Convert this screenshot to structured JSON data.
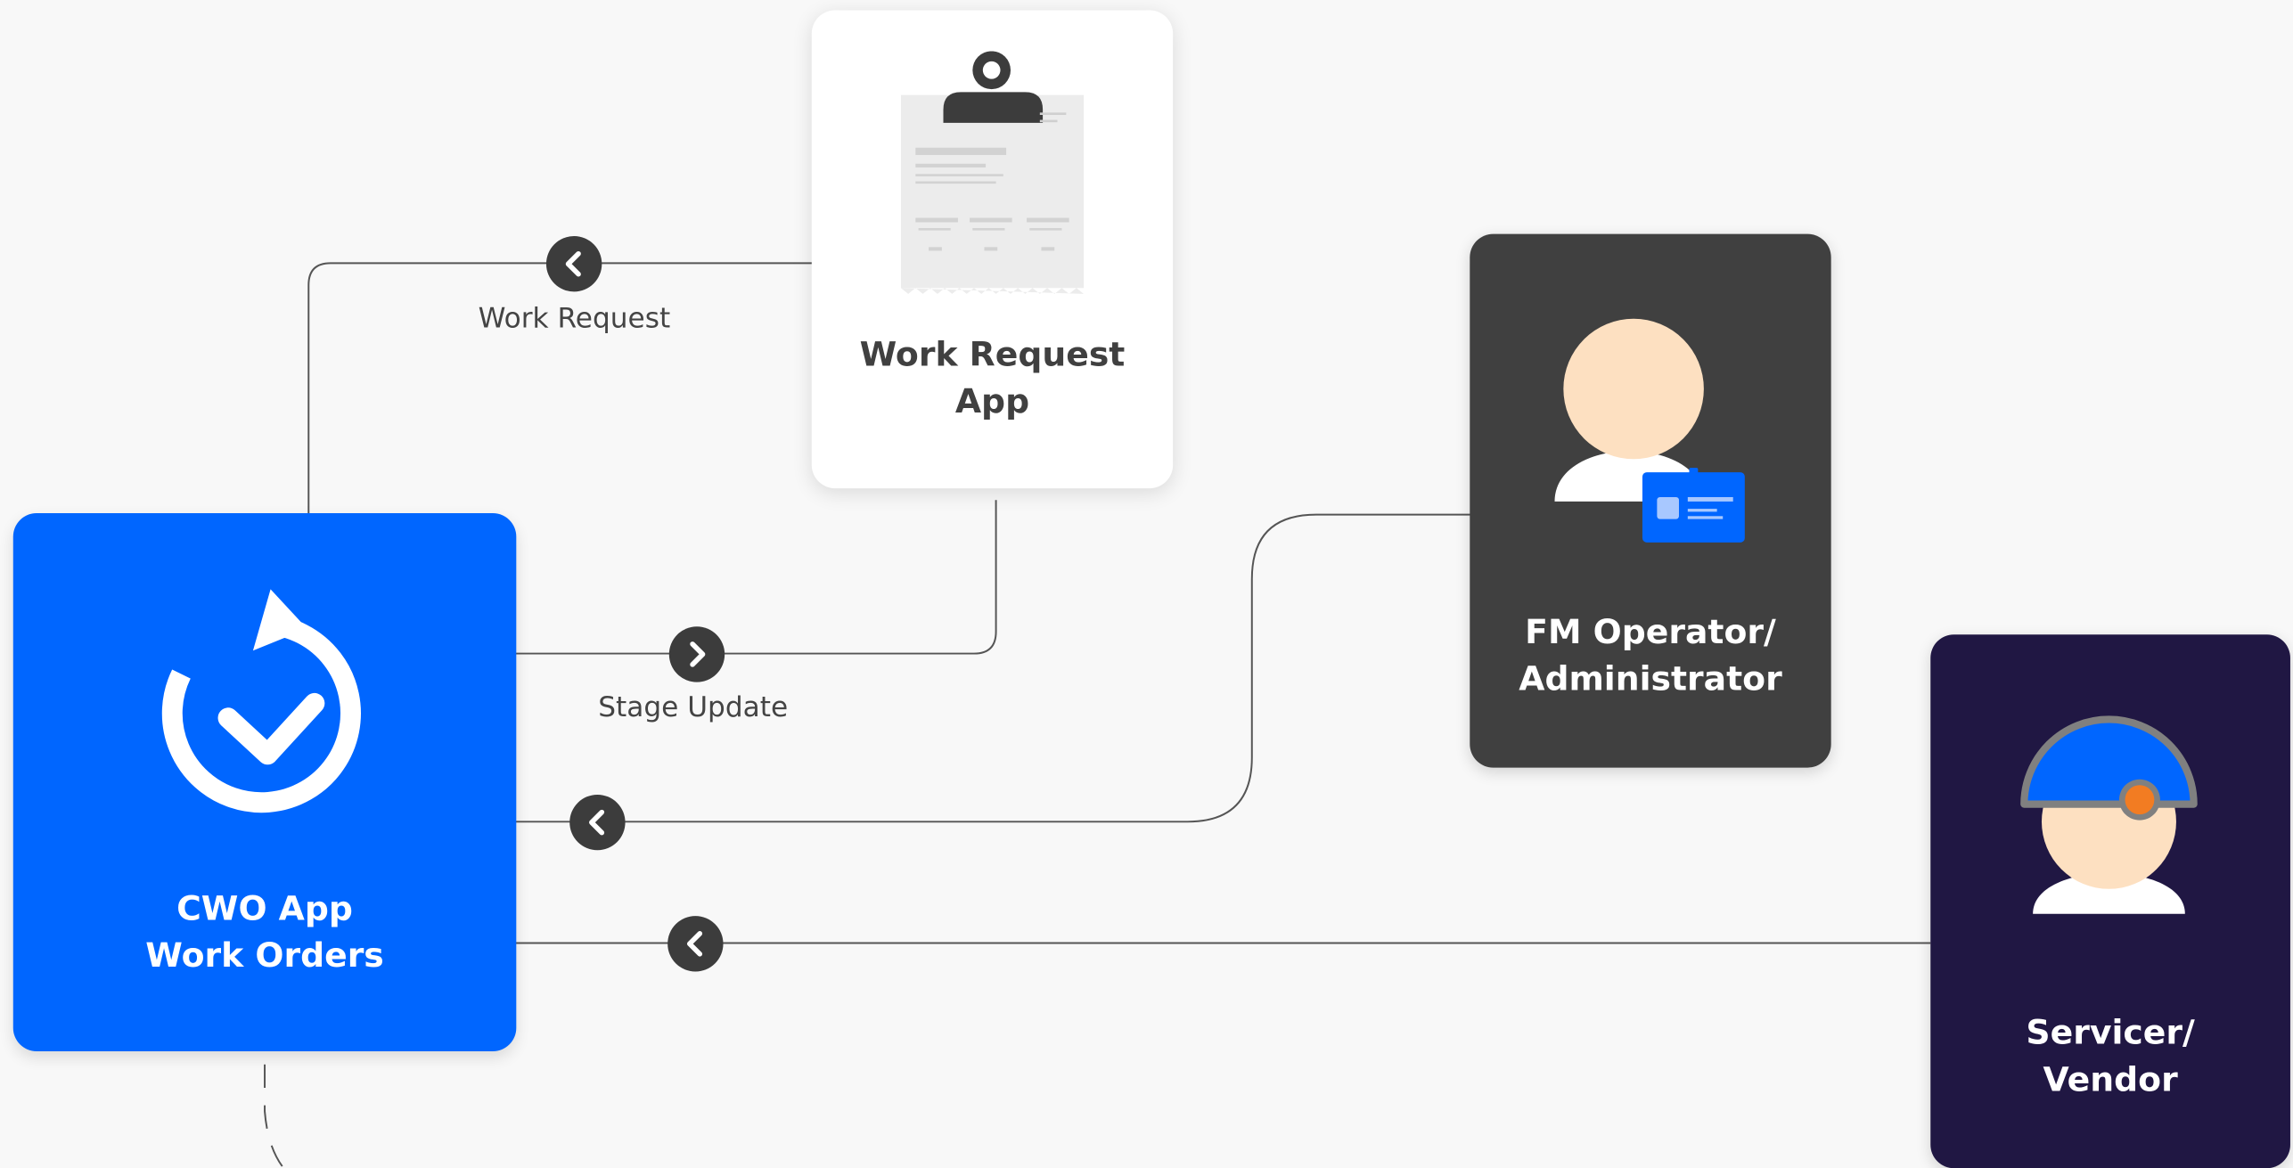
{
  "nodes": {
    "cwo": {
      "line1": "CWO App",
      "line2": "Work Orders",
      "icon": "refresh-check-icon",
      "color": "#0066ff"
    },
    "work_request_app": {
      "line1": "Work Request",
      "line2": "App",
      "icon": "clipboard-icon",
      "color": "#ffffff"
    },
    "fm_operator": {
      "line1": "FM Operator/",
      "line2": "Administrator",
      "icon": "operator-with-id-badge-icon",
      "color": "#404040"
    },
    "servicer": {
      "line1": "Servicer/",
      "line2": "Vendor",
      "icon": "worker-with-helmet-icon",
      "color": "#201743"
    }
  },
  "edges": {
    "work_request": {
      "label": "Work Request",
      "arrow": "chevron-left-icon"
    },
    "stage_update": {
      "label": "Stage Update",
      "arrow": "chevron-right-icon"
    },
    "fm_to_cwo": {
      "label": "",
      "arrow": "chevron-left-icon"
    },
    "vendor_to_cwo": {
      "label": "",
      "arrow": "chevron-left-icon"
    }
  },
  "colors": {
    "line": "#555555",
    "arrow_badge": "#3c3c3c",
    "skin": "#fde0c1",
    "helmet": "#0066ff",
    "helmet_light": "#f27c22"
  }
}
